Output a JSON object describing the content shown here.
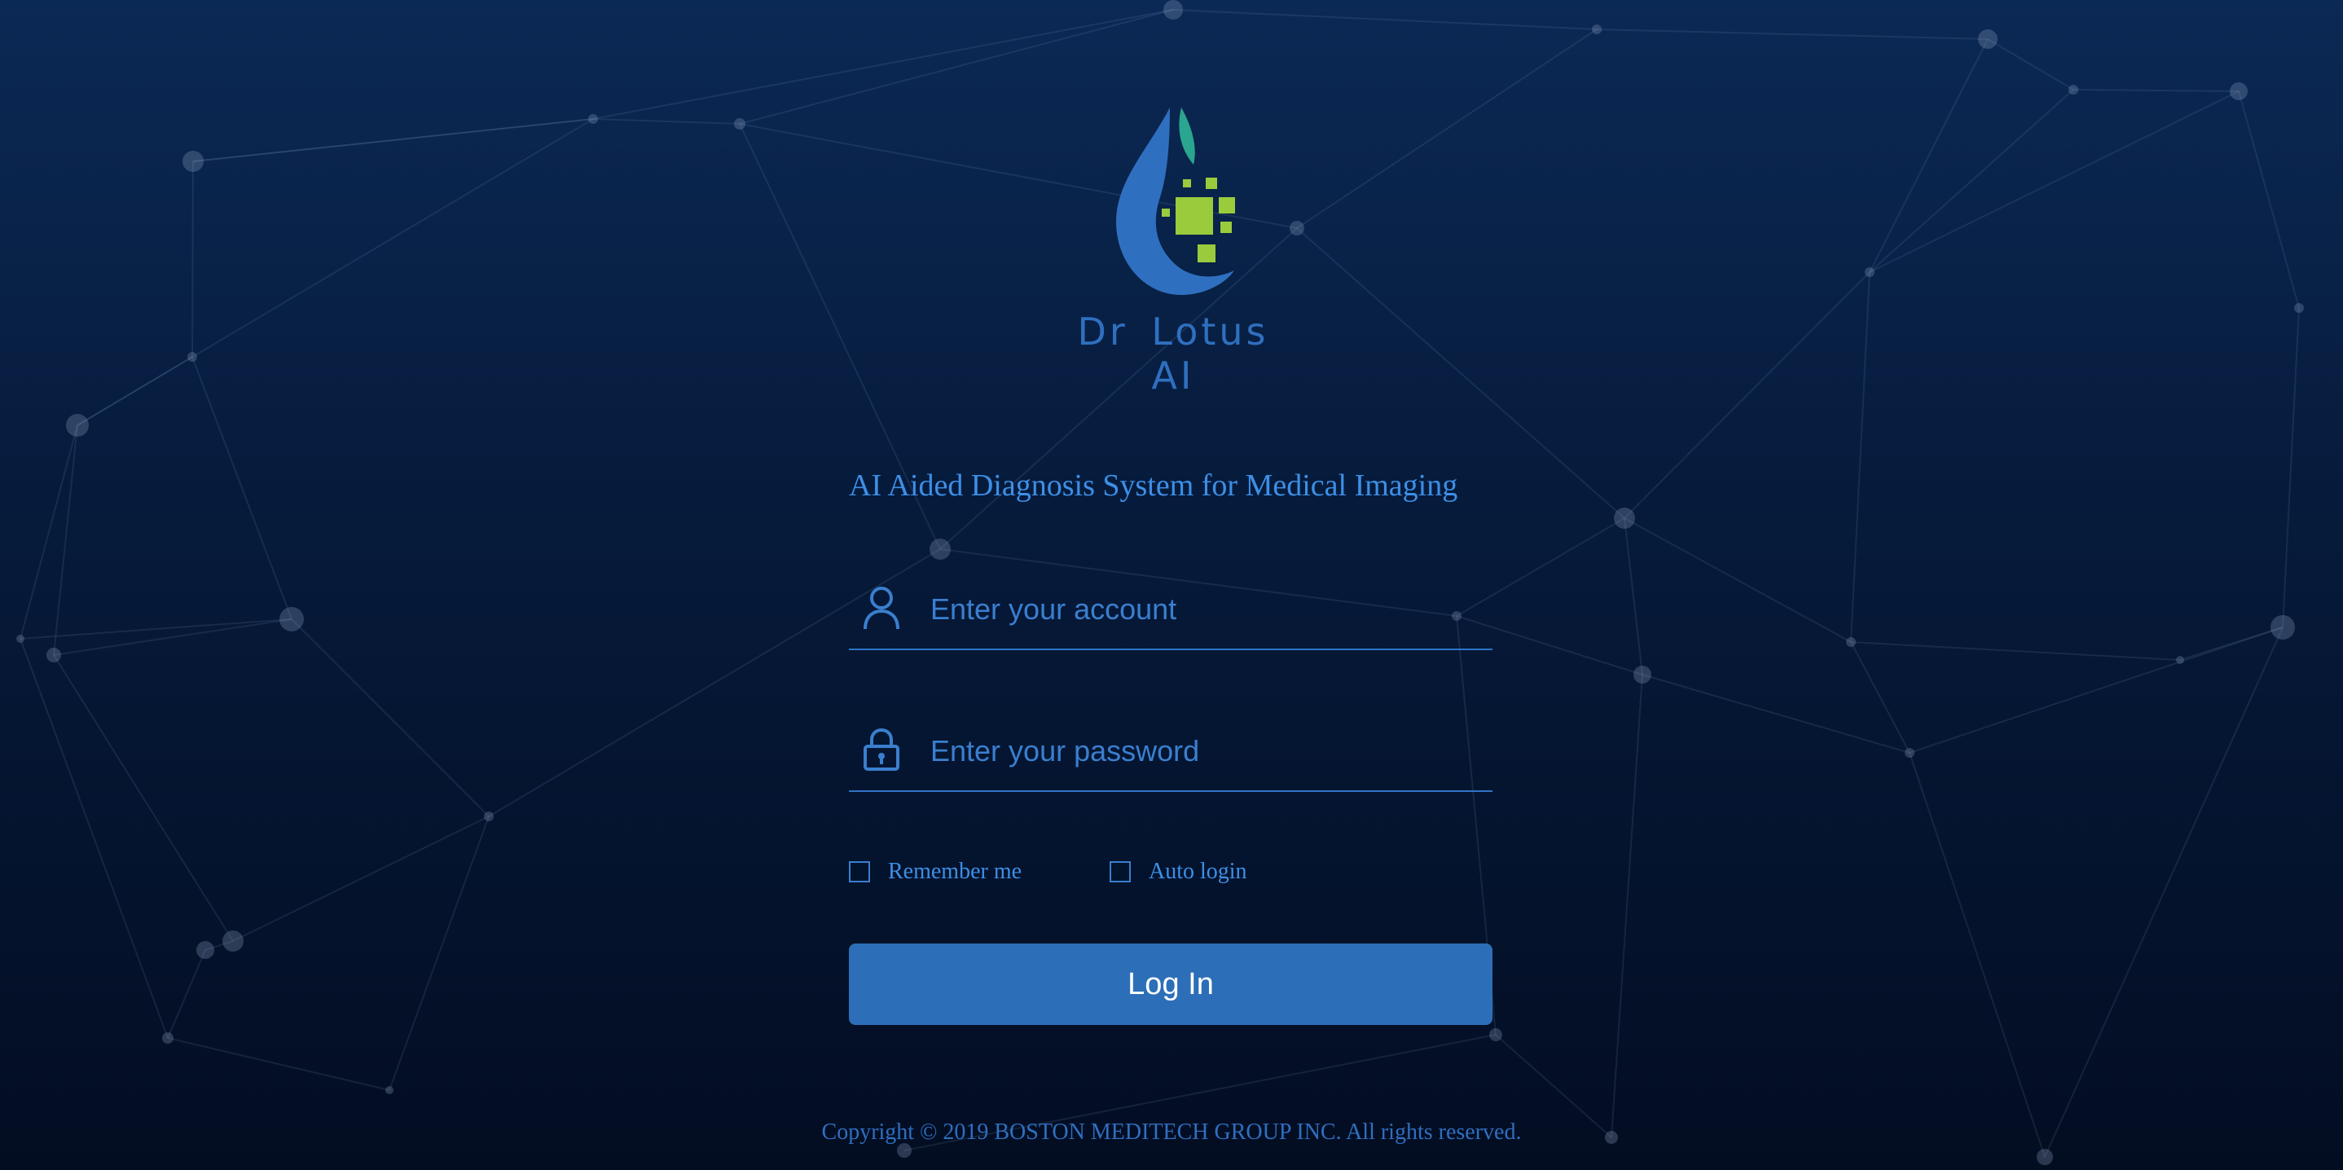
{
  "brand": {
    "name": "Dr Lotus AI",
    "logo_icon": "water-drop-pixel-logo",
    "colors": {
      "drop_blue": "#2f6fbf",
      "leaf_teal": "#2aa58f",
      "pixel_green": "#9acb3c"
    }
  },
  "login": {
    "system_title": "AI Aided Diagnosis System for Medical Imaging",
    "account_placeholder": "Enter your account",
    "account_icon": "user-icon",
    "password_placeholder": "Enter your password",
    "password_icon": "lock-icon",
    "remember_label": "Remember me",
    "remember_checked": false,
    "auto_login_label": "Auto login",
    "auto_login_checked": false,
    "submit_label": "Log In"
  },
  "footer": {
    "copyright": "Copyright © 2019 BOSTON MEDITECH GROUP INC. All rights reserved."
  },
  "theme": {
    "background_top": "#0b2955",
    "background_bottom": "#030d22",
    "accent": "#2c6fb8",
    "text_accent": "#3d8fe6"
  }
}
